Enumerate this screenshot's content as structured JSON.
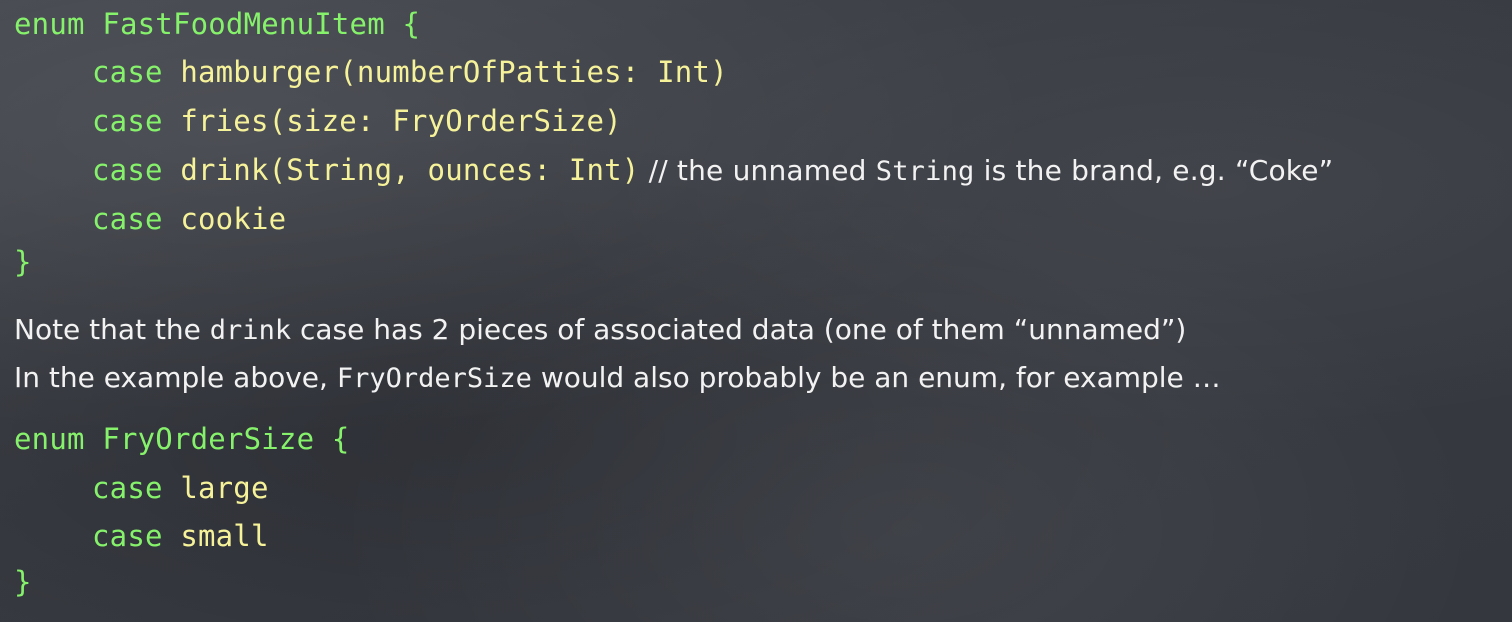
{
  "colors": {
    "background": "#3a3d44",
    "keyword_green": "#86f26b",
    "identifier_yellow": "#f6f29a",
    "text_white": "#f2f2f2"
  },
  "block1": {
    "decl_keyword": "enum ",
    "decl_name": "FastFoodMenuItem {",
    "case1_kw": "case ",
    "case1_rest": "hamburger(numberOfPatties: Int)",
    "case2_kw": "case ",
    "case2_rest": "fries(size: FryOrderSize)",
    "case3_kw": "case ",
    "case3_rest": "drink(String, ounces: Int)",
    "comment_prefix": " // the unnamed ",
    "comment_code": "String",
    "comment_suffix": " is the brand, e.g. “Coke”",
    "case4_kw": "case ",
    "case4_rest": "cookie",
    "close": "}"
  },
  "note": {
    "l1_a": "Note that the ",
    "l1_code": "drink",
    "l1_b": " case has 2 pieces of associated data (one of them “unnamed”)",
    "l2_a": "In the example above, ",
    "l2_code": "FryOrderSize",
    "l2_b": " would also probably be an enum, for example …"
  },
  "block2": {
    "decl_keyword": "enum ",
    "decl_name": "FryOrderSize {",
    "case1_kw": "case ",
    "case1_rest": "large",
    "case2_kw": "case ",
    "case2_rest": "small",
    "close": "}"
  }
}
